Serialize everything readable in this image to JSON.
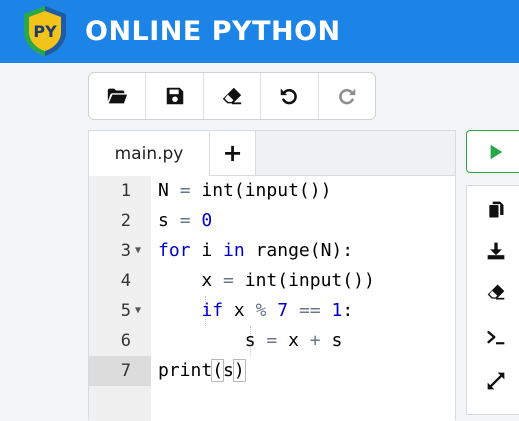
{
  "header": {
    "logo_text": "PY",
    "brand": "ONLINE PYTHON",
    "colors": {
      "bar": "#1d84e7",
      "logo_yellow": "#f2c318",
      "logo_green": "#2aa84a",
      "logo_blue": "#1e5aa8"
    }
  },
  "toolbar": {
    "buttons": [
      {
        "icon": "folder-open-icon"
      },
      {
        "icon": "save-icon"
      },
      {
        "icon": "eraser-icon"
      },
      {
        "icon": "undo-icon"
      },
      {
        "icon": "redo-icon"
      }
    ]
  },
  "editor": {
    "tab_label": "main.py",
    "add_tab_label": "+",
    "active_line": 7,
    "lines": [
      {
        "number": "1",
        "foldable": false
      },
      {
        "number": "2",
        "foldable": false
      },
      {
        "number": "3",
        "foldable": true
      },
      {
        "number": "4",
        "foldable": false
      },
      {
        "number": "5",
        "foldable": true
      },
      {
        "number": "6",
        "foldable": false
      },
      {
        "number": "7",
        "foldable": false
      }
    ],
    "tokens": {
      "l1": [
        "N",
        "=",
        "int(input())"
      ],
      "l2": [
        "s",
        "=",
        "0"
      ],
      "l3": [
        "for",
        "i",
        "in",
        "range(N):"
      ],
      "l4": [
        "x",
        "=",
        "int(input())"
      ],
      "l5": [
        "if",
        "x",
        "%",
        "7",
        "==",
        "1",
        ":"
      ],
      "l6": [
        "s",
        "=",
        "x",
        "+",
        "s"
      ],
      "l7": [
        "print",
        "(",
        "s",
        ")"
      ]
    }
  },
  "sidebar": {
    "run_icon": "play-icon",
    "tools": [
      "copy-icon",
      "download-icon",
      "eraser-icon",
      "terminal-icon",
      "expand-icon"
    ],
    "colors": {
      "run": "#27a84a"
    }
  }
}
